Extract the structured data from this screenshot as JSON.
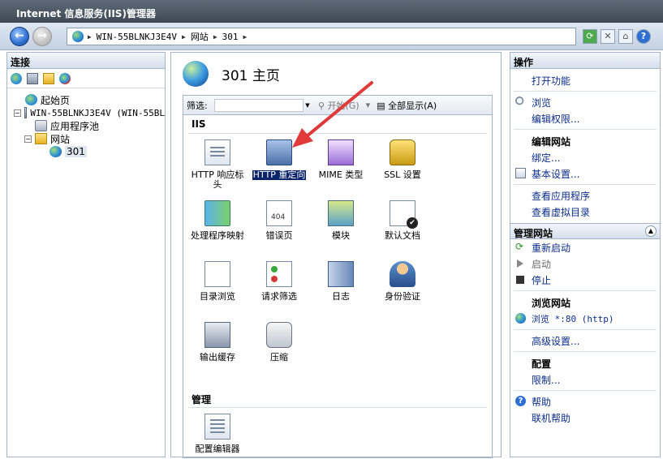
{
  "window": {
    "title": "Internet 信息服务(IIS)管理器"
  },
  "address": {
    "crumbs": [
      "WIN-55BLNKJ3E4V",
      "网站",
      "301"
    ]
  },
  "connections": {
    "header": "连接",
    "tree": [
      {
        "label": "起始页"
      },
      {
        "label": "WIN-55BLNKJ3E4V (WIN-55BL"
      },
      {
        "label": "应用程序池"
      },
      {
        "label": "网站"
      },
      {
        "label": "301"
      }
    ]
  },
  "page": {
    "title": "301 主页"
  },
  "filter": {
    "label": "筛选:",
    "start_label": "开始(G)",
    "showall_label": "全部显示(A)"
  },
  "sections": [
    {
      "name": "IIS",
      "features": [
        {
          "label": "HTTP 响应标头",
          "icon": "doc-icon"
        },
        {
          "label": "HTTP 重定向",
          "icon": "redirect-icon",
          "selected": true
        },
        {
          "label": "MIME 类型",
          "icon": "media-icon"
        },
        {
          "label": "SSL 设置",
          "icon": "lock-icon"
        },
        {
          "label": "处理程序映射",
          "icon": "arrows-icon"
        },
        {
          "label": "错误页",
          "icon": "error-page-icon"
        },
        {
          "label": "模块",
          "icon": "module-icon"
        },
        {
          "label": "默认文档",
          "icon": "default-doc-icon"
        },
        {
          "label": "目录浏览",
          "icon": "browse-icon"
        },
        {
          "label": "请求筛选",
          "icon": "filter-icon"
        },
        {
          "label": "日志",
          "icon": "log-icon"
        },
        {
          "label": "身份验证",
          "icon": "auth-icon"
        },
        {
          "label": "输出缓存",
          "icon": "cache-icon"
        },
        {
          "label": "压缩",
          "icon": "compress-icon"
        }
      ]
    },
    {
      "name": "管理",
      "features": [
        {
          "label": "配置编辑器",
          "icon": "config-icon"
        }
      ]
    }
  ],
  "actions": {
    "header": "操作",
    "top": [
      {
        "label": "打开功能"
      },
      {
        "label": "浏览"
      },
      {
        "label": "编辑权限..."
      },
      {
        "label": "编辑网站"
      },
      {
        "label": "绑定..."
      },
      {
        "label": "基本设置..."
      },
      {
        "label": "查看应用程序"
      },
      {
        "label": "查看虚拟目录"
      }
    ],
    "manage_header": "管理网站",
    "manage": [
      {
        "label": "重新启动"
      },
      {
        "label": "启动"
      },
      {
        "label": "停止"
      },
      {
        "label": "浏览网站"
      },
      {
        "label": "浏览 *:80 (http)"
      },
      {
        "label": "高级设置..."
      },
      {
        "label": "配置"
      },
      {
        "label": "限制..."
      },
      {
        "label": "帮助"
      },
      {
        "label": "联机帮助"
      }
    ]
  }
}
